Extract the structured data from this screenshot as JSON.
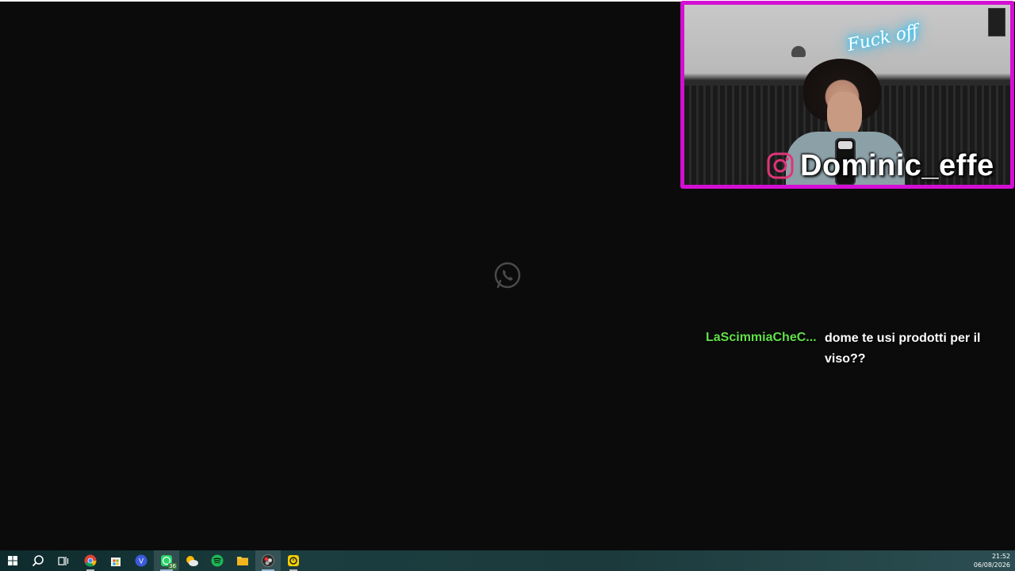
{
  "colors": {
    "webcam_border": "#d40fd4",
    "chat_username": "#62e04a",
    "neon": "#1ec8ff",
    "taskbar": "#1b3d3f"
  },
  "center_icon": "whatsapp-icon",
  "webcam": {
    "neon_text": "Fuck off",
    "username": "Dominic_effe",
    "social_icon": "instagram-icon"
  },
  "chat": {
    "username": "LaScimmiaCheC...",
    "message": "dome te usi prodotti per il viso??"
  },
  "taskbar": {
    "icons": [
      {
        "name": "windows-start-icon"
      },
      {
        "name": "search-icon"
      },
      {
        "name": "task-view-icon"
      },
      {
        "name": "chrome-icon"
      },
      {
        "name": "store-icon"
      },
      {
        "name": "vivaldi-icon"
      },
      {
        "name": "whatsapp-icon",
        "badge": "36"
      },
      {
        "name": "weather-icon"
      },
      {
        "name": "spotify-icon"
      },
      {
        "name": "file-explorer-icon"
      },
      {
        "name": "obs-icon"
      },
      {
        "name": "app-icon"
      }
    ],
    "time": "21:52",
    "date": "06/08/2026"
  }
}
